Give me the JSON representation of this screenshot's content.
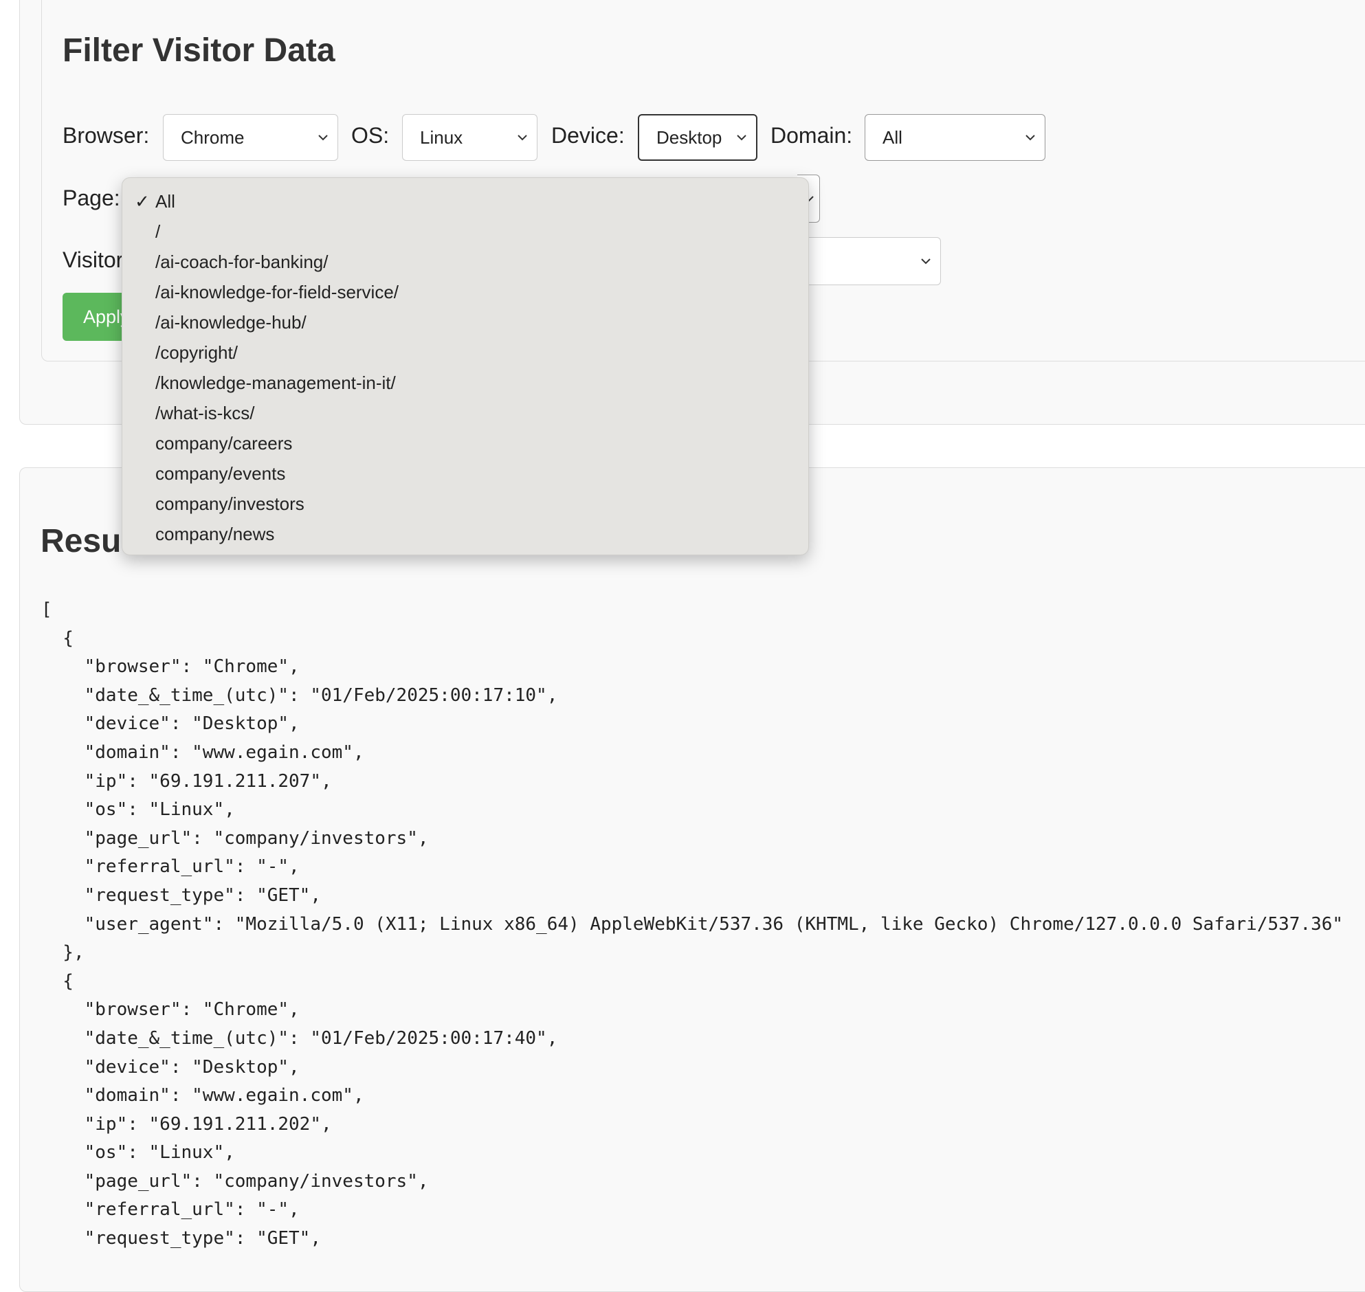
{
  "filter": {
    "title": "Filter Visitor Data",
    "browser": {
      "label": "Browser:",
      "value": "Chrome"
    },
    "os": {
      "label": "OS:",
      "value": "Linux"
    },
    "device": {
      "label": "Device:",
      "value": "Desktop"
    },
    "domain": {
      "label": "Domain:",
      "value": "All"
    },
    "page": {
      "label": "Page:"
    },
    "visitor": {
      "label": "Visitor"
    },
    "apply_label": "Apply"
  },
  "page_dropdown": {
    "selected": "All",
    "options": [
      "All",
      "/",
      "/ai-coach-for-banking/",
      "/ai-knowledge-for-field-service/",
      "/ai-knowledge-hub/",
      "/copyright/",
      "/knowledge-management-in-it/",
      "/what-is-kcs/",
      "company/careers",
      "company/events",
      "company/investors",
      "company/news"
    ]
  },
  "results": {
    "title": "Resu",
    "lines": [
      "[",
      "  {",
      "    \"browser\": \"Chrome\",",
      "    \"date_&_time_(utc)\": \"01/Feb/2025:00:17:10\",",
      "    \"device\": \"Desktop\",",
      "    \"domain\": \"www.egain.com\",",
      "    \"ip\": \"69.191.211.207\",",
      "    \"os\": \"Linux\",",
      "    \"page_url\": \"company/investors\",",
      "    \"referral_url\": \"-\",",
      "    \"request_type\": \"GET\",",
      "    \"user_agent\": \"Mozilla/5.0 (X11; Linux x86_64) AppleWebKit/537.36 (KHTML, like Gecko) Chrome/127.0.0.0 Safari/537.36\"",
      "  },",
      "  {",
      "    \"browser\": \"Chrome\",",
      "    \"date_&_time_(utc)\": \"01/Feb/2025:00:17:40\",",
      "    \"device\": \"Desktop\",",
      "    \"domain\": \"www.egain.com\",",
      "    \"ip\": \"69.191.211.202\",",
      "    \"os\": \"Linux\",",
      "    \"page_url\": \"company/investors\",",
      "    \"referral_url\": \"-\",",
      "    \"request_type\": \"GET\","
    ]
  },
  "colors": {
    "apply_button": "#5cb85c",
    "card_background": "#f9f9f9",
    "dropdown_background": "#e5e4e1"
  },
  "icons": {
    "select_arrow": "chevron-down-icon",
    "selected_option": "checkmark-icon"
  }
}
